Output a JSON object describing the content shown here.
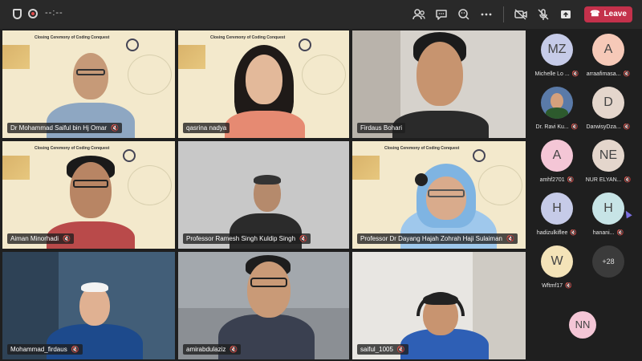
{
  "topbar": {
    "timer": "--:--",
    "leave_label": "Leave",
    "icons": [
      "shield-icon",
      "record-icon",
      "people-icon",
      "chat-icon",
      "reactions-icon",
      "more-icon",
      "camera-off-icon",
      "mic-off-icon",
      "share-icon",
      "phone-icon"
    ]
  },
  "poster": {
    "title": "Closing Ceremony of Coding Conquest"
  },
  "tiles": [
    {
      "name": "Dr Mohammad Saiful bin Hj Omar"
    },
    {
      "name": "qasrina nadya"
    },
    {
      "name": "Firdaus Bohari"
    },
    {
      "name": "Aiman Minorhadi"
    },
    {
      "name": "Professor Ramesh Singh Kuldip Singh"
    },
    {
      "name": "Professor Dr Dayang Hajah Zohrah Haji Sulaiman"
    },
    {
      "name": "Mohammad_firdaus"
    },
    {
      "name": "amirabdulaziz"
    },
    {
      "name": "saiful_1005"
    }
  ],
  "participants": [
    {
      "initials": "MZ",
      "name": "Michelle Lo ...",
      "color": "#c6cbe8"
    },
    {
      "initials": "A",
      "name": "arraafimasa...",
      "color": "#f6c9b8"
    },
    {
      "initials": "",
      "name": "Dr. Ravi Ku...",
      "color": "#5a7aa8"
    },
    {
      "initials": "D",
      "name": "DarwisyDza...",
      "color": "#e4d6cc"
    },
    {
      "initials": "A",
      "name": "amhf2701",
      "color": "#f4c6d6"
    },
    {
      "initials": "NE",
      "name": "NUR ELYAN...",
      "color": "#e4d6cc"
    },
    {
      "initials": "H",
      "name": "hadizulkiflee",
      "color": "#c6cbe8"
    },
    {
      "initials": "H",
      "name": "hanani...",
      "color": "#c7e4e6"
    },
    {
      "initials": "W",
      "name": "Wftmf17",
      "color": "#f4e3b8"
    },
    {
      "initials": "+28",
      "name": "",
      "color": "#3b3b3b"
    }
  ],
  "self": {
    "initials": "NN",
    "color": "#f4c6d6"
  }
}
